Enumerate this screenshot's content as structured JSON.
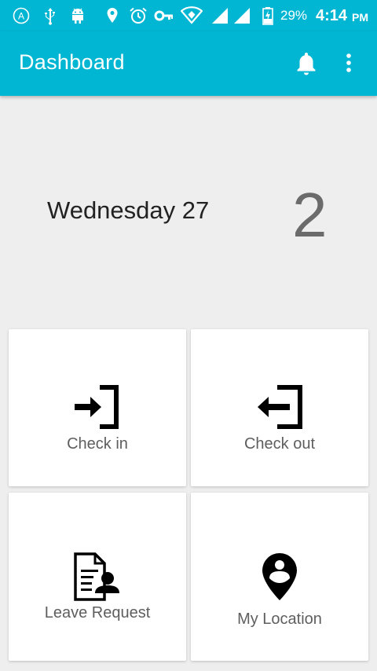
{
  "status_bar": {
    "battery": "29%",
    "time": "4:14",
    "ampm": "PM",
    "icons": [
      "a-circle-icon",
      "usb-icon",
      "android-icon",
      "location-pin-icon",
      "alarm-icon",
      "key-icon",
      "wifi-icon",
      "signal-icon",
      "signal-icon",
      "battery-charging-icon"
    ]
  },
  "app_bar": {
    "title": "Dashboard",
    "actions": [
      "bell-icon",
      "more-vert-icon"
    ]
  },
  "summary": {
    "day": "Wednesday 27",
    "count": "2"
  },
  "cards": [
    {
      "label": "Check in",
      "icon": "login-icon"
    },
    {
      "label": "Check out",
      "icon": "logout-icon"
    },
    {
      "label": "Leave Request",
      "icon": "document-person-icon"
    },
    {
      "label": "My Location",
      "icon": "location-person-icon"
    }
  ],
  "colors": {
    "primary": "#00b6d3",
    "background": "#eeeeee",
    "card": "#ffffff",
    "label": "#5e5e5e"
  }
}
